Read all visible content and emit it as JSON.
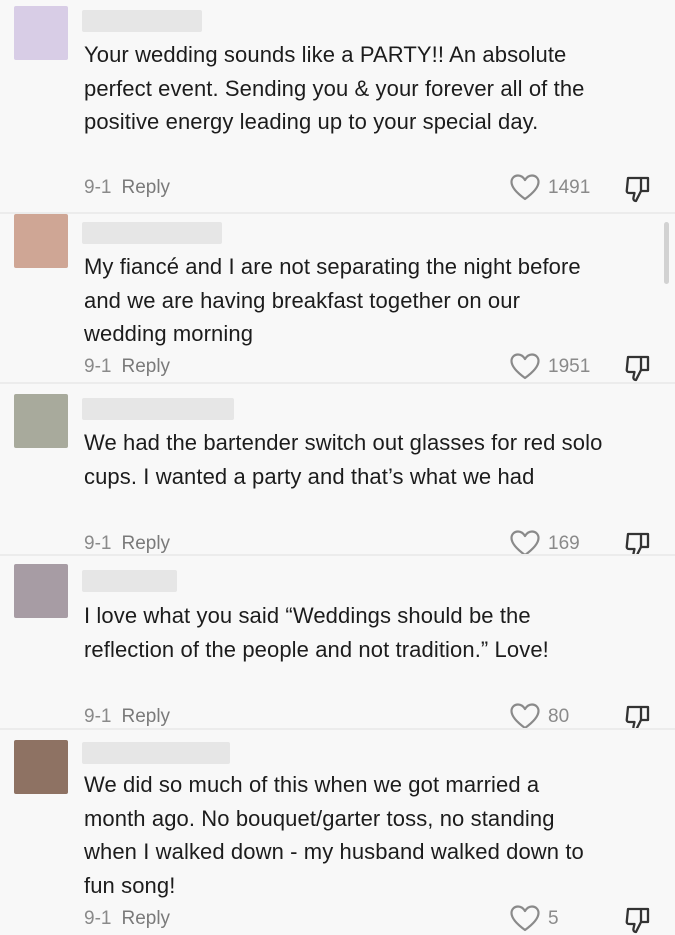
{
  "comments": [
    {
      "avatar_color": "#d8cde6",
      "text": "Your wedding sounds like a PARTY!! An absolute perfect event. Sending you & your forever all of the positive energy leading up to your special day.",
      "date": "9-1",
      "reply_label": "Reply",
      "likes": "1491"
    },
    {
      "avatar_color": "#cfa695",
      "text": "My fiancé and I are not separating the night before and we are having breakfast together on our wedding morning",
      "date": "9-1",
      "reply_label": "Reply",
      "likes": "1951"
    },
    {
      "avatar_color": "#a8aa9c",
      "text": "We had the bartender switch out glasses for red solo cups. I wanted a party and that’s what we had",
      "date": "9-1",
      "reply_label": "Reply",
      "likes": "169"
    },
    {
      "avatar_color": "#a79ca4",
      "text": "I love what you said “Weddings should be the reflection of the people and not tradition.” Love!",
      "date": "9-1",
      "reply_label": "Reply",
      "likes": "80"
    },
    {
      "avatar_color": "#8e7263",
      "text": "We did so much of this when we got married a month ago. No bouquet/garter toss, no standing when I walked down - my husband walked down to fun song!",
      "date": "9-1",
      "reply_label": "Reply",
      "likes": "5"
    }
  ]
}
